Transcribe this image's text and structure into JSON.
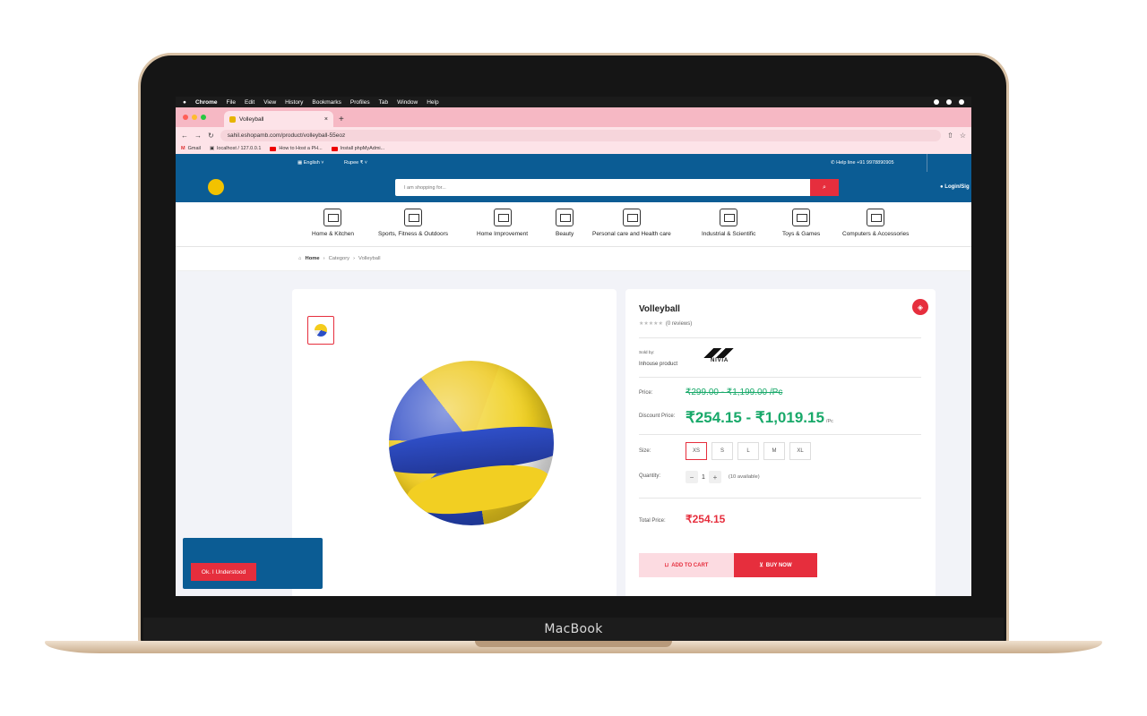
{
  "device": {
    "brand_label": "MacBook"
  },
  "macos_menu": {
    "apple": "",
    "app": "Chrome",
    "items": [
      "File",
      "Edit",
      "View",
      "History",
      "Bookmarks",
      "Profiles",
      "Tab",
      "Window",
      "Help"
    ]
  },
  "browser": {
    "tab_title": "Volleyball",
    "tab_close": "×",
    "new_tab": "+",
    "url": "sahil.eshopamb.com/product/volleyball-55eoz",
    "bookmarks": [
      "Gmail",
      "localhost / 127.0.0.1",
      "How to Host a PH...",
      "Install phpMyAdmi..."
    ]
  },
  "site": {
    "language": "English",
    "currency": "Rupee ₹",
    "helpline": "Help line +91 9978890905",
    "search_placeholder": "I am shopping for...",
    "login": "Login/Sig",
    "categories": [
      "Home & Kitchen",
      "Sports, Fitness & Outdoors",
      "Home Improvement",
      "Beauty",
      "Personal care and Health care",
      "Industrial & Scientific",
      "Toys & Games",
      "Computers & Accessories"
    ],
    "breadcrumb": {
      "home": "Home",
      "category": "Category",
      "current": "Volleyball"
    }
  },
  "product": {
    "title": "Volleyball",
    "stars": "★★★★★",
    "reviews": "(0 reviews)",
    "sold_by_label": "Sold by:",
    "seller": "Inhouse product",
    "brand": "NIVIA",
    "price_label": "Price:",
    "old_price": "₹299.00 - ₹1,199.00 /Pc",
    "discount_label": "Discount Price:",
    "discount_price": "₹254.15 - ₹1,019.15",
    "unit": "/Pc",
    "size_label": "Size:",
    "sizes": [
      "XS",
      "S",
      "L",
      "M",
      "XL"
    ],
    "selected_size": "XS",
    "quantity_label": "Quantity:",
    "quantity": "1",
    "available": "(10 available)",
    "total_label": "Total Price:",
    "total": "₹254.15",
    "add_to_cart": "ADD TO CART",
    "buy_now": "BUY NOW"
  },
  "cookie": {
    "button": "Ok. I Understood"
  },
  "colors": {
    "primary": "#0b5c94",
    "accent": "#e62e3d",
    "price_green": "#19a96a"
  }
}
